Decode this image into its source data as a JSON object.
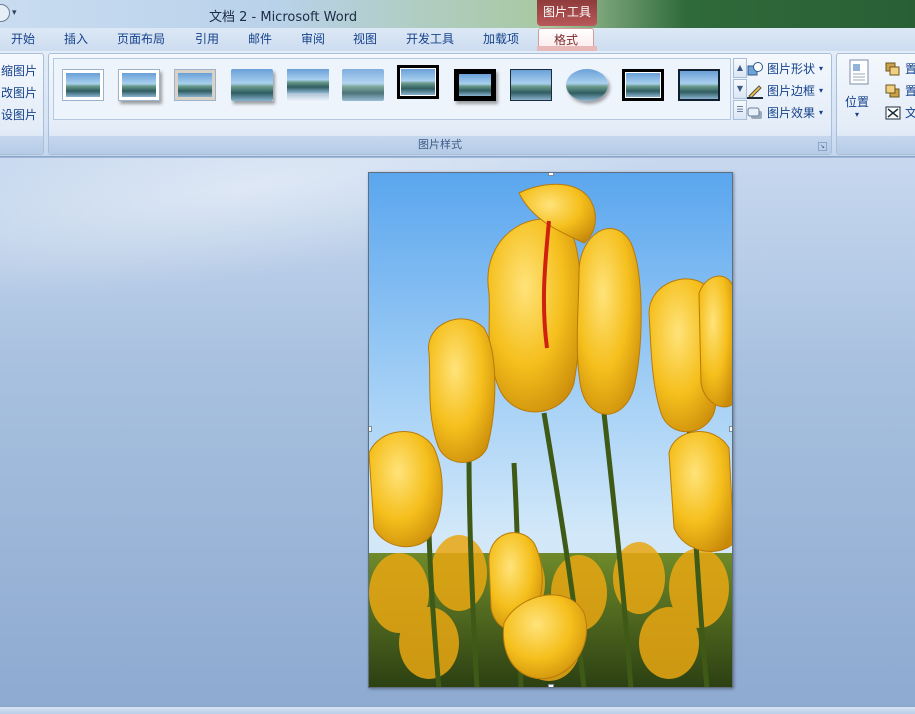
{
  "app": {
    "title": "文档 2 - Microsoft Word",
    "context_tab_group": "图片工具"
  },
  "tabs": [
    {
      "label": "开始",
      "active": false
    },
    {
      "label": "插入",
      "active": false
    },
    {
      "label": "页面布局",
      "active": false
    },
    {
      "label": "引用",
      "active": false
    },
    {
      "label": "邮件",
      "active": false
    },
    {
      "label": "审阅",
      "active": false
    },
    {
      "label": "视图",
      "active": false
    },
    {
      "label": "开发工具",
      "active": false
    },
    {
      "label": "加载项",
      "active": false
    },
    {
      "label": "格式",
      "active": true
    }
  ],
  "ribbon": {
    "adjust_group": {
      "compress": "缩图片",
      "change": "改图片",
      "reset": "设图片"
    },
    "picture_styles_group": {
      "label": "图片样式",
      "styles": [
        "simple-frame-white",
        "beveled-matte-white",
        "metal-frame",
        "drop-shadow-rectangle",
        "reflected-rounded-rectangle",
        "soft-edge-rectangle",
        "double-frame-black",
        "thick-matte-black",
        "simple-frame-black",
        "bevel-perspective-oval",
        "compound-frame-black",
        "center-shadow-rectangle"
      ],
      "shape_label": "图片形状",
      "border_label": "图片边框",
      "effects_label": "图片效果"
    },
    "arrange_group": {
      "position_label": "位置",
      "bring_front": "置",
      "send_back": "置",
      "text_wrap": "文"
    }
  },
  "document": {
    "picture_subject": "yellow tulips"
  },
  "colors": {
    "active_tab_accent": "#d49a9c",
    "context_tab": "#b8585a",
    "ribbon_text": "#15428b"
  }
}
